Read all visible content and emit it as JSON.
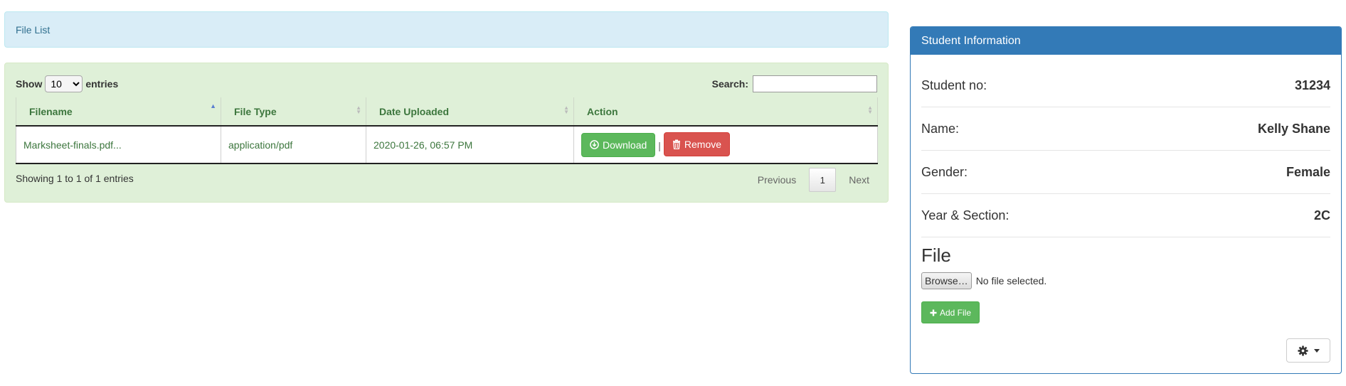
{
  "file_list_panel": {
    "title": "File List"
  },
  "table_controls": {
    "show_label": "Show",
    "entries_value": "10",
    "entries_options": [
      "10"
    ],
    "entries_label": "entries",
    "search_label": "Search:",
    "search_value": ""
  },
  "table": {
    "columns": [
      "Filename",
      "File Type",
      "Date Uploaded",
      "Action"
    ],
    "rows": [
      {
        "filename": "Marksheet-finals.pdf...",
        "file_type": "application/pdf",
        "date_uploaded": "2020-01-26, 06:57 PM"
      }
    ],
    "download_label": "Download",
    "separator": "|",
    "remove_label": "Remove"
  },
  "pagination": {
    "info": "Showing 1 to 1 of 1 entries",
    "previous": "Previous",
    "current_page": "1",
    "next": "Next"
  },
  "student_panel": {
    "title": "Student Information",
    "fields": [
      {
        "label": "Student no:",
        "value": "31234"
      },
      {
        "label": "Name:",
        "value": "Kelly Shane"
      },
      {
        "label": "Gender:",
        "value": "Female"
      },
      {
        "label": "Year & Section:",
        "value": "2C"
      }
    ],
    "file_heading": "File",
    "browse_label": "Browse…",
    "no_file_text": "No file selected.",
    "add_file_label": "Add File"
  },
  "icons": {
    "download": "download-circle-icon",
    "remove": "trash-icon",
    "add": "plus-icon",
    "settings": "gear-icon",
    "caret": "caret-down-icon"
  },
  "colors": {
    "info_bg": "#d9edf7",
    "success_bg": "#dff0d8",
    "primary": "#337ab7",
    "success": "#5cb85c",
    "danger": "#d9534f"
  }
}
